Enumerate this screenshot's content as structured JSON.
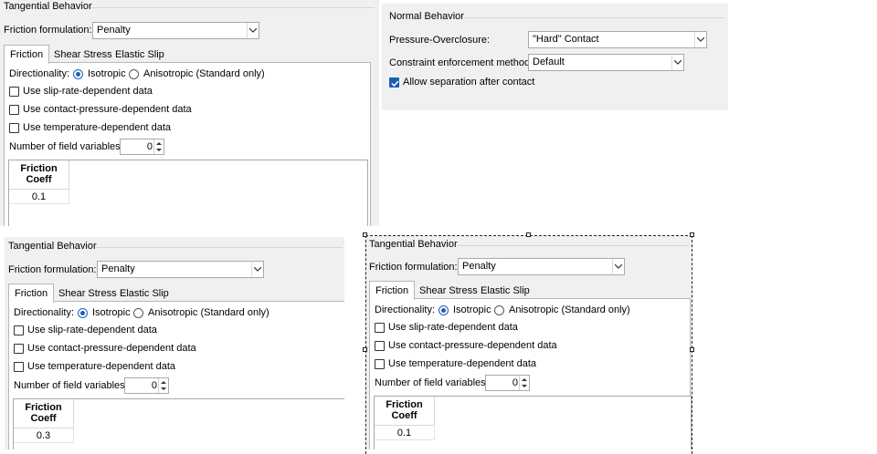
{
  "panels": [
    {
      "title": "Tangential Behavior",
      "friction_label": "Friction formulation:",
      "friction_value": "Penalty",
      "tabs": [
        "Friction",
        "Shear Stress",
        "Elastic Slip"
      ],
      "directionality_label": "Directionality:",
      "isotropic_label": "Isotropic",
      "anisotropic_label": "Anisotropic (Standard only)",
      "checks": [
        "Use slip-rate-dependent data",
        "Use contact-pressure-dependent data",
        "Use temperature-dependent data"
      ],
      "field_vars_label": "Number of field variables:",
      "field_vars_value": "0",
      "table_header_1": "Friction",
      "table_header_2": "Coeff",
      "table_value": "0.1"
    },
    {
      "title": "Tangential Behavior",
      "friction_label": "Friction formulation:",
      "friction_value": "Penalty",
      "tabs": [
        "Friction",
        "Shear Stress",
        "Elastic Slip"
      ],
      "directionality_label": "Directionality:",
      "isotropic_label": "Isotropic",
      "anisotropic_label": "Anisotropic (Standard only)",
      "checks": [
        "Use slip-rate-dependent data",
        "Use contact-pressure-dependent data",
        "Use temperature-dependent data"
      ],
      "field_vars_label": "Number of field variables:",
      "field_vars_value": "0",
      "table_header_1": "Friction",
      "table_header_2": "Coeff",
      "table_value": "0.3"
    },
    {
      "title": "Tangential Behavior",
      "friction_label": "Friction formulation:",
      "friction_value": "Penalty",
      "tabs": [
        "Friction",
        "Shear Stress",
        "Elastic Slip"
      ],
      "directionality_label": "Directionality:",
      "isotropic_label": "Isotropic",
      "anisotropic_label": "Anisotropic (Standard only)",
      "checks": [
        "Use slip-rate-dependent data",
        "Use contact-pressure-dependent data",
        "Use temperature-dependent data"
      ],
      "field_vars_label": "Number of field variables:",
      "field_vars_value": "0",
      "table_header_1": "Friction",
      "table_header_2": "Coeff",
      "table_value": "0.1"
    }
  ],
  "normal": {
    "title": "Normal Behavior",
    "pressure_label": "Pressure-Overclosure:",
    "pressure_value": "\"Hard\" Contact",
    "constraint_label": "Constraint enforcement method:",
    "constraint_value": "Default",
    "separation_label": "Allow separation after contact",
    "separation_checked": true
  },
  "colors": {
    "panel_bg": "#f0f0f0",
    "accent": "#1a5fb4",
    "border": "#a9a9a9"
  },
  "icons": {
    "combo_arrow": "chevron-down-icon",
    "spin": "spinner-arrows-icon",
    "check": "checkmark-icon"
  }
}
